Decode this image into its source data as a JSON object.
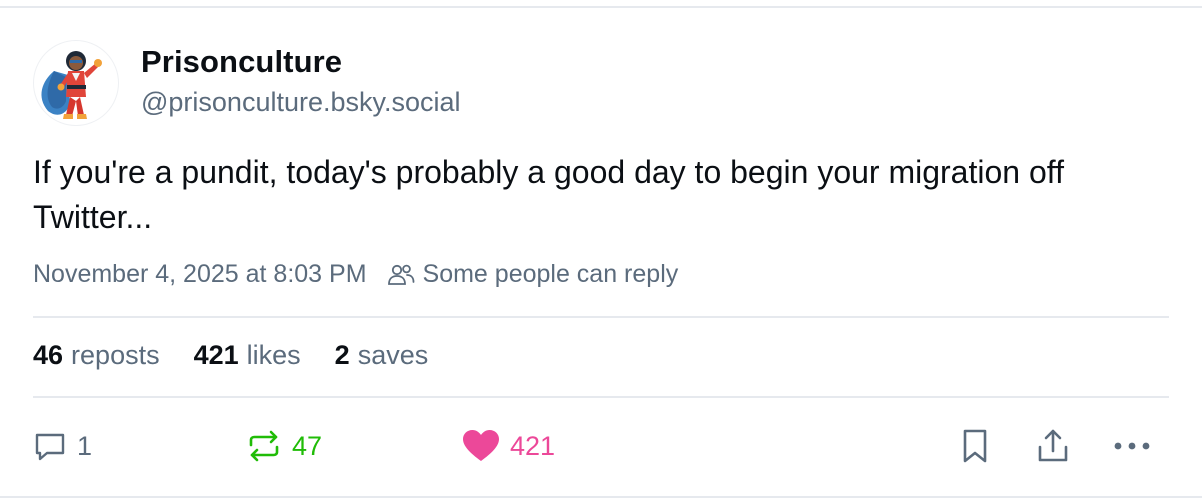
{
  "author": {
    "display_name": "Prisonculture",
    "handle": "@prisonculture.bsky.social",
    "avatar_icon": "superhero-avatar-icon"
  },
  "post": {
    "text": "If you're a pundit, today's probably a good day to begin your migration off Twitter...",
    "timestamp": "November 4, 2025 at 8:03 PM",
    "reply_setting": "Some people can reply"
  },
  "stats": {
    "reposts_count": "46",
    "reposts_label": "reposts",
    "likes_count": "421",
    "likes_label": "likes",
    "saves_count": "2",
    "saves_label": "saves"
  },
  "actions": {
    "reply_count": "1",
    "repost_count": "47",
    "like_count": "421"
  },
  "colors": {
    "text_primary": "#0b0f14",
    "text_secondary": "#5b6b7c",
    "repost_active": "#20bc07",
    "like_active": "#ec4899",
    "divider": "#e6e9ee"
  }
}
